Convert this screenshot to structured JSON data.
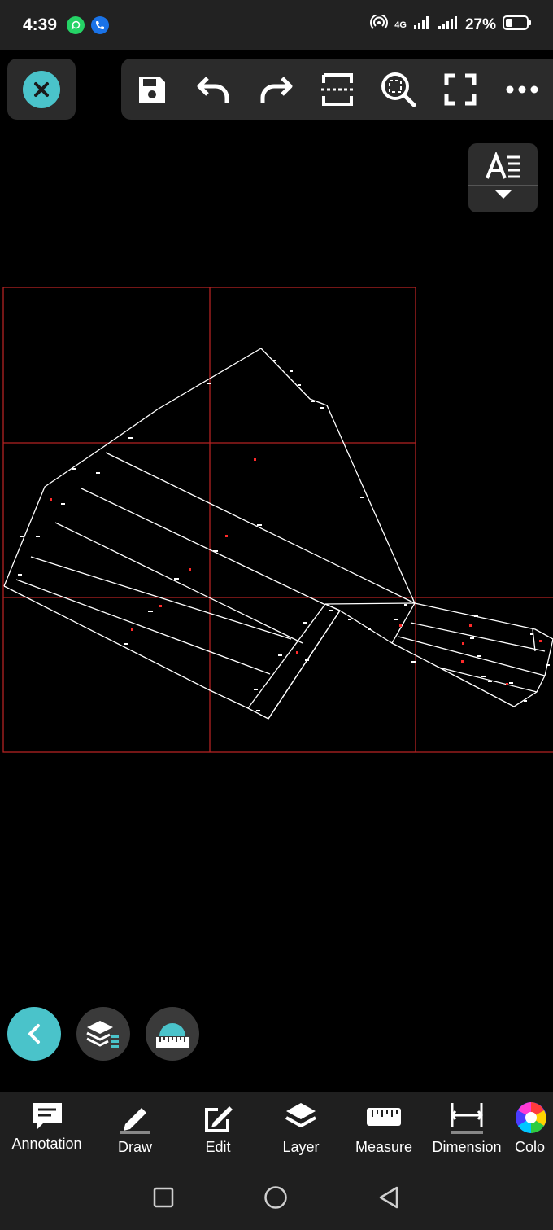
{
  "status_bar": {
    "time": "4:39",
    "network": "4G",
    "battery": "27%"
  },
  "bottom_toolbar": {
    "items": [
      {
        "label": "Annotation",
        "icon": "annotation-icon"
      },
      {
        "label": "Draw",
        "icon": "pencil-icon"
      },
      {
        "label": "Edit",
        "icon": "edit-icon"
      },
      {
        "label": "Layer",
        "icon": "layers-icon"
      },
      {
        "label": "Measure",
        "icon": "ruler-icon"
      },
      {
        "label": "Dimension",
        "icon": "dimension-icon"
      },
      {
        "label": "Colo",
        "icon": "color-wheel-icon"
      }
    ]
  },
  "colors": {
    "accent": "#4ac3ca",
    "grid": "#b22222",
    "panel": "#2b2b2b",
    "drawing": "#ffffff"
  }
}
